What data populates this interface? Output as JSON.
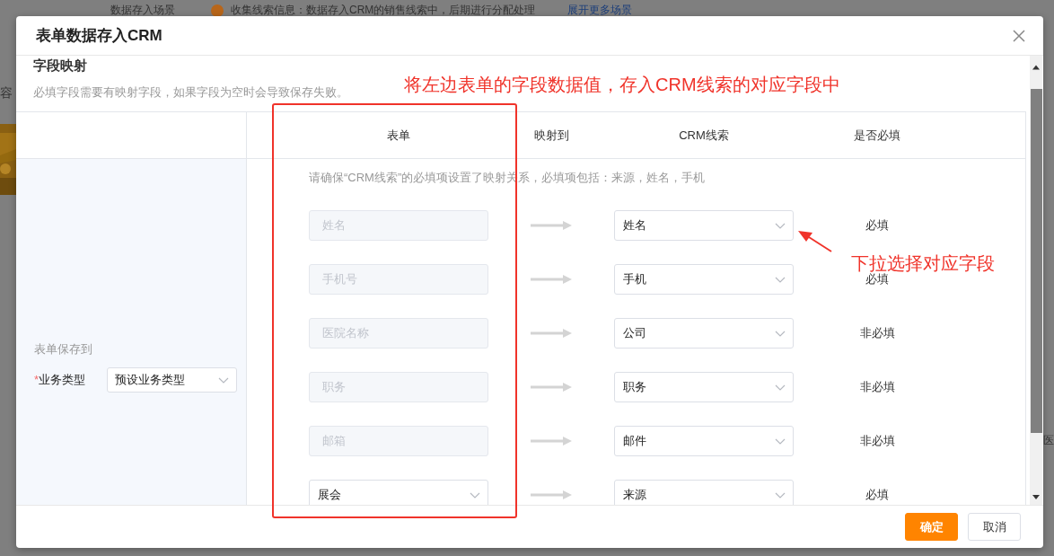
{
  "background": {
    "scene_label": "数据存入场景",
    "scene_hint": "收集线索信息：数据存入CRM的销售线索中，后期进行分配处理",
    "expand_link": "展开更多场景",
    "side_text": "容",
    "right_text": "医"
  },
  "dialog": {
    "title": "表单数据存入CRM",
    "section_title": "字段映射",
    "section_hint": "必填字段需要有映射字段，如果字段为空时会导致保存失败。",
    "columns": [
      "表单",
      "映射到",
      "CRM线索",
      "是否必填"
    ],
    "save_to": {
      "label": "表单保存到",
      "required_mark": "*",
      "field_label": "业务类型",
      "value": "预设业务类型"
    },
    "notice": "请确保“CRM线索”的必填项设置了映射关系，必填项包括：来源，姓名，手机",
    "rows": [
      {
        "kind": "field",
        "source": "姓名",
        "target": "姓名",
        "requirement": "必填"
      },
      {
        "kind": "field",
        "source": "手机号",
        "target": "手机",
        "requirement": "必填"
      },
      {
        "kind": "field",
        "source": "医院名称",
        "target": "公司",
        "requirement": "非必填"
      },
      {
        "kind": "field",
        "source": "职务",
        "target": "职务",
        "requirement": "非必填"
      },
      {
        "kind": "field",
        "source": "邮箱",
        "target": "邮件",
        "requirement": "非必填"
      },
      {
        "kind": "select",
        "source": "展会",
        "target": "来源",
        "requirement": "必填"
      }
    ],
    "buttons": [
      {
        "label": "确定",
        "primary": true
      },
      {
        "label": "取消",
        "primary": false
      }
    ]
  },
  "annotations": [
    {
      "kind": "box"
    },
    {
      "kind": "note",
      "text": "将左边表单的字段数据值，存入CRM线索的对应字段中"
    },
    {
      "kind": "arrow"
    },
    {
      "kind": "note",
      "text": "下拉选择对应字段"
    }
  ]
}
